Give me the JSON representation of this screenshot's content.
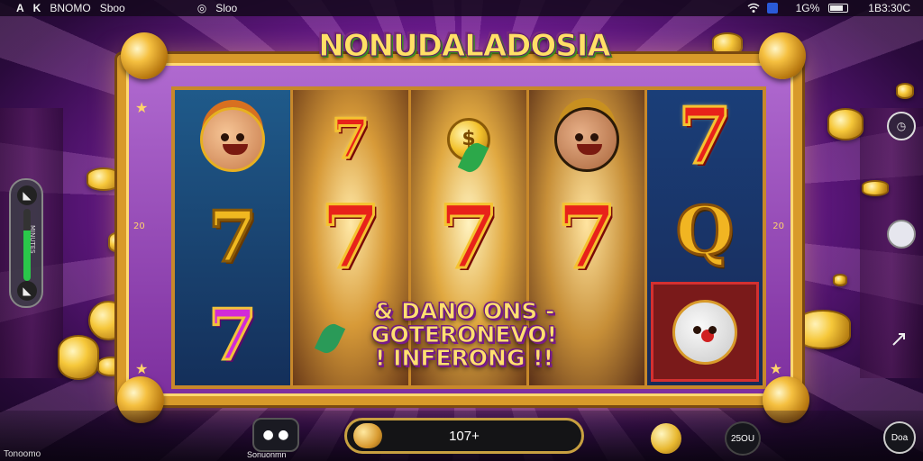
{
  "status_bar": {
    "left_icons": [
      "A",
      "K"
    ],
    "app_label_1": "BNOMO",
    "app_label_2": "Sboo",
    "back_glyph": "◎",
    "app_label_3": "Sloo",
    "battery_pct": "1G%",
    "time": "1B3:30C"
  },
  "game": {
    "title": "NONUDALADOSIA",
    "win_banner": {
      "line1": "& DANO ONS -",
      "line2": "GOTERONEVO!",
      "line3": "! INFERONG !!"
    },
    "reel_side_glyphs": {
      "left": "20",
      "right": "20"
    }
  },
  "left_panel": {
    "top_glyph": "◣",
    "bottom_glyph": "◣",
    "meter_label": "MINUTES",
    "meter_fill_fraction": 0.7
  },
  "right_controls": {
    "top_glyph": "◷"
  },
  "bottom": {
    "corner_label": "Tonoomo",
    "menu_glyph": "● ●",
    "menu_label": "Sonuonmn",
    "bet_value": "107+",
    "balance_label": "25OU",
    "info_label": "Doa"
  },
  "colors": {
    "frame_gold": "#d89a2a",
    "title_yellow": "#ffe066",
    "seven_red": "#e8221a",
    "seven_purple": "#d22ad8",
    "meter_green": "#2ac84a"
  },
  "icons": [
    "wifi-icon",
    "bluetooth-icon",
    "battery-icon",
    "menu-icon",
    "coin-icon",
    "settings-icon",
    "info-icon"
  ]
}
